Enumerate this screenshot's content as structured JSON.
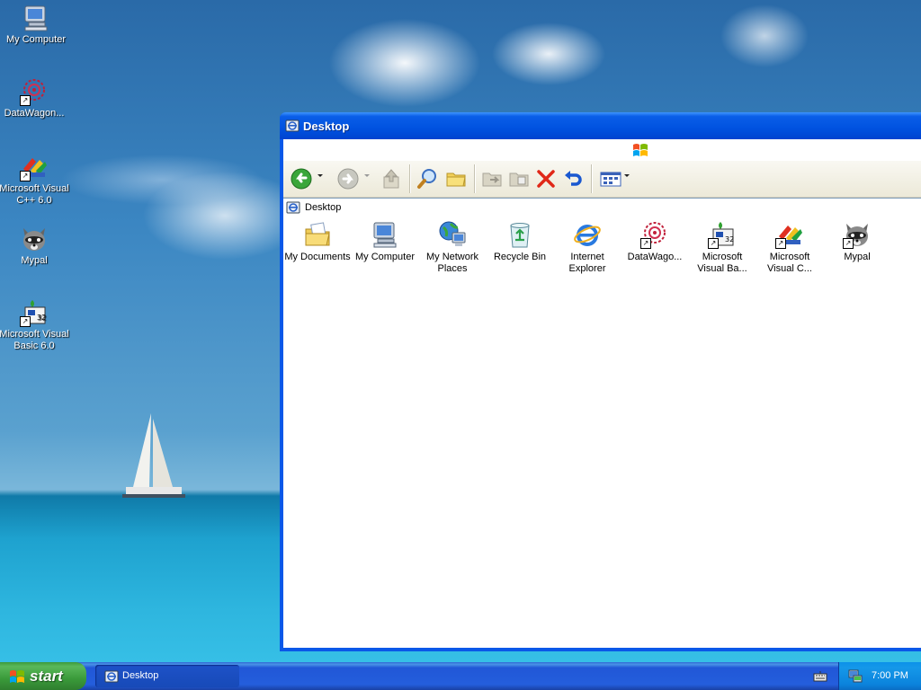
{
  "desktop": {
    "icons": [
      {
        "label": "My Computer",
        "icon": "my-computer-icon"
      },
      {
        "label": "DataWagon...",
        "icon": "datawagon-icon"
      },
      {
        "label": "Microsoft Visual C++ 6.0",
        "icon": "visual-cpp-icon"
      },
      {
        "label": "Mypal",
        "icon": "mypal-icon"
      },
      {
        "label": "Microsoft Visual Basic 6.0",
        "icon": "visual-basic-icon"
      }
    ]
  },
  "window": {
    "title": "Desktop",
    "address": "Desktop",
    "toolbar": {
      "buttons": [
        "back",
        "forward",
        "up",
        "search",
        "folders",
        "move-to",
        "copy-to",
        "delete",
        "undo",
        "views"
      ]
    },
    "items": [
      {
        "label": "My Documents",
        "icon": "my-documents-icon"
      },
      {
        "label": "My Computer",
        "icon": "my-computer-icon"
      },
      {
        "label": "My Network Places",
        "icon": "network-places-icon"
      },
      {
        "label": "Recycle Bin",
        "icon": "recycle-bin-icon"
      },
      {
        "label": "Internet Explorer",
        "icon": "internet-explorer-icon"
      },
      {
        "label": "DataWago...",
        "icon": "datawagon-icon"
      },
      {
        "label": "Microsoft Visual Ba...",
        "icon": "visual-basic-icon"
      },
      {
        "label": "Microsoft Visual C...",
        "icon": "visual-cpp-icon"
      },
      {
        "label": "Mypal",
        "icon": "mypal-icon"
      }
    ]
  },
  "taskbar": {
    "start_label": "start",
    "task_label": "Desktop",
    "clock": "7:00 PM"
  },
  "colors": {
    "titlebar": "#0054e3",
    "taskbar": "#245edc",
    "start": "#3c9a3c",
    "tray": "#0c91e9"
  }
}
